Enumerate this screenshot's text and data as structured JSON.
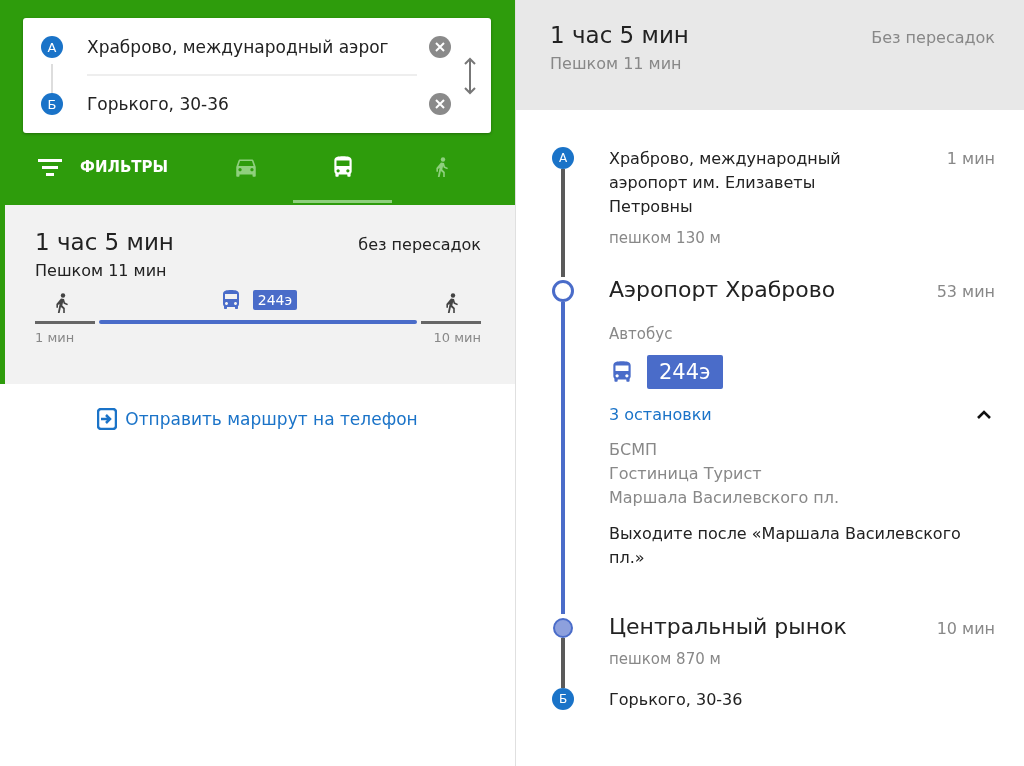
{
  "directions": {
    "origin": {
      "marker": "А",
      "value": "Храброво, международный аэрог"
    },
    "destination": {
      "marker": "Б",
      "value": "Горького, 30-36"
    }
  },
  "mode_tabs": [
    {
      "kind": "filter",
      "label": "ФИЛЬТРЫ",
      "selected": false
    },
    {
      "kind": "car",
      "selected": false
    },
    {
      "kind": "transit",
      "selected": true
    },
    {
      "kind": "walk",
      "selected": false
    }
  ],
  "route_card": {
    "duration": "1 час 5 мин",
    "transfers": "без пересадок",
    "walking": "Пешком 11 мин",
    "segments": [
      {
        "kind": "walk",
        "duration": "1 мин"
      },
      {
        "kind": "bus",
        "route": "244э"
      },
      {
        "kind": "walk",
        "duration": "10 мин"
      }
    ]
  },
  "send_link": "Отправить маршрут на телефон",
  "details": {
    "duration": "1 час 5 мин",
    "transfers": "Без пересадок",
    "walking": "Пешком 11 мин",
    "steps": [
      {
        "kind": "origin",
        "marker": "А",
        "name": "Храброво, международный аэропорт им. Елизаветы Петровны",
        "time": "1 мин",
        "walk": "пешком 130 м",
        "leg": {
          "kind": "walk"
        }
      },
      {
        "kind": "board",
        "name": "Аэропорт Храброво",
        "time": "53 мин",
        "vehicle": "Автобус",
        "route": "244э",
        "stops_toggle": "3 остановки",
        "expanded": true,
        "stops": [
          "БСМП",
          "Гостиница Турист",
          "Маршала Василевского пл."
        ],
        "exit_hint": "Выходите после «Маршала Василевского пл.»",
        "leg": {
          "kind": "bus"
        }
      },
      {
        "kind": "alight",
        "name": "Центральный рынок",
        "time": "10 мин",
        "walk": "пешком 870 м",
        "leg": {
          "kind": "walk"
        }
      },
      {
        "kind": "destination",
        "marker": "Б",
        "name": "Горького, 30-36"
      }
    ]
  }
}
